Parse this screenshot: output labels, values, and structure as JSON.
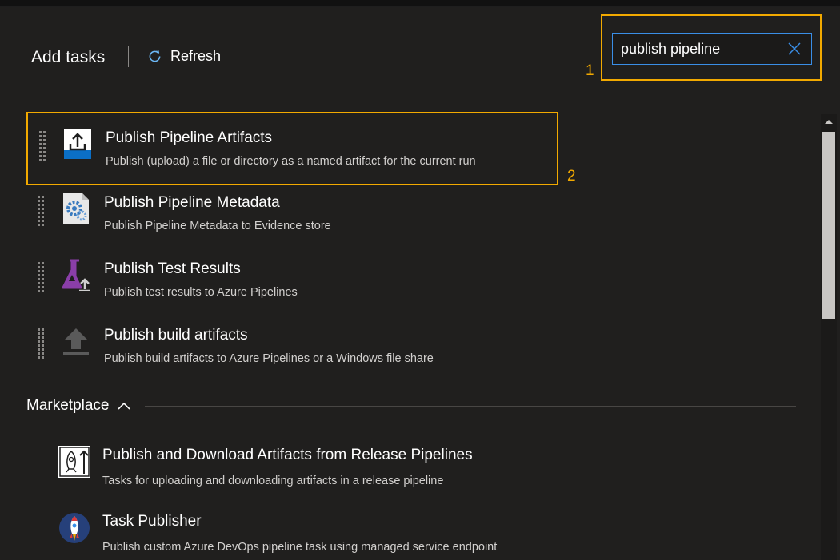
{
  "header": {
    "title": "Add tasks",
    "refresh_label": "Refresh"
  },
  "search": {
    "value": "publish pipeline",
    "placeholder": "Search"
  },
  "callouts": [
    "1",
    "2"
  ],
  "tasks": [
    {
      "title": "Publish Pipeline Artifacts",
      "description": "Publish (upload) a file or directory as a named artifact for the current run",
      "icon": "upload-artifact-icon"
    },
    {
      "title": "Publish Pipeline Metadata",
      "description": "Publish Pipeline Metadata to Evidence store",
      "icon": "metadata-gear-icon"
    },
    {
      "title": "Publish Test Results",
      "description": "Publish test results to Azure Pipelines",
      "icon": "test-flask-icon"
    },
    {
      "title": "Publish build artifacts",
      "description": "Publish build artifacts to Azure Pipelines or a Windows file share",
      "icon": "upload-arrow-icon"
    }
  ],
  "marketplace": {
    "label": "Marketplace",
    "items": [
      {
        "title": "Publish and Download Artifacts from Release Pipelines",
        "description": "Tasks for uploading and downloading artifacts in a release pipeline",
        "icon": "rocket-artifact-icon"
      },
      {
        "title": "Task Publisher",
        "description": "Publish custom Azure DevOps pipeline task using managed service endpoint",
        "icon": "rocket-badge-icon"
      }
    ]
  },
  "colors": {
    "highlight": "#f2a900",
    "accent": "#3a8ee6",
    "background": "#201f1e"
  }
}
